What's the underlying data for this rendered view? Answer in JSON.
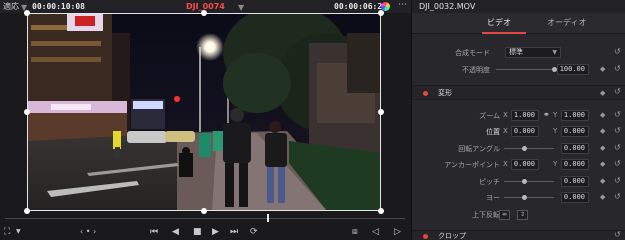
{
  "viewer": {
    "fit_label": "適応",
    "timecode_in": "00:00:10:08",
    "clip_name": "DJI_0074",
    "timecode_out": "00:00:06:24",
    "controls": {
      "transform_icon": "transform-icon",
      "options_icon": "chevron-down-icon",
      "jog_icon": "jog-icon",
      "first_frame_icon": "first-frame-icon",
      "prev_frame_icon": "prev-frame-icon",
      "stop_icon": "stop-icon",
      "play_icon": "play-icon",
      "next_frame_icon": "next-frame-icon",
      "loop_icon": "loop-icon"
    }
  },
  "inspector": {
    "file_name": "DJI_0032.MOV",
    "tabs": [
      "ビデオ",
      "オーディオ"
    ],
    "active_tab": 0,
    "composite": {
      "mode_label": "合成モード",
      "mode_value": "標準",
      "opacity_label": "不透明度",
      "opacity_value": "100.00",
      "opacity_level": 1.0
    },
    "transform": {
      "title": "変形",
      "zoom_label": "ズーム",
      "zoom_x": "1.000",
      "zoom_y": "1.000",
      "position_label": "位置",
      "position_x": "0.000",
      "position_y": "0.000",
      "rotation_label": "回転アングル",
      "rotation_value": "0.000",
      "anchor_label": "アンカーポイント",
      "anchor_x": "0.000",
      "anchor_y": "0.000",
      "pitch_label": "ピッチ",
      "pitch_value": "0.000",
      "yaw_label": "ヨー",
      "yaw_value": "0.000",
      "flip_label": "上下反転",
      "axis_x": "X",
      "axis_y": "Y"
    },
    "crop": {
      "title": "クロップ"
    }
  }
}
